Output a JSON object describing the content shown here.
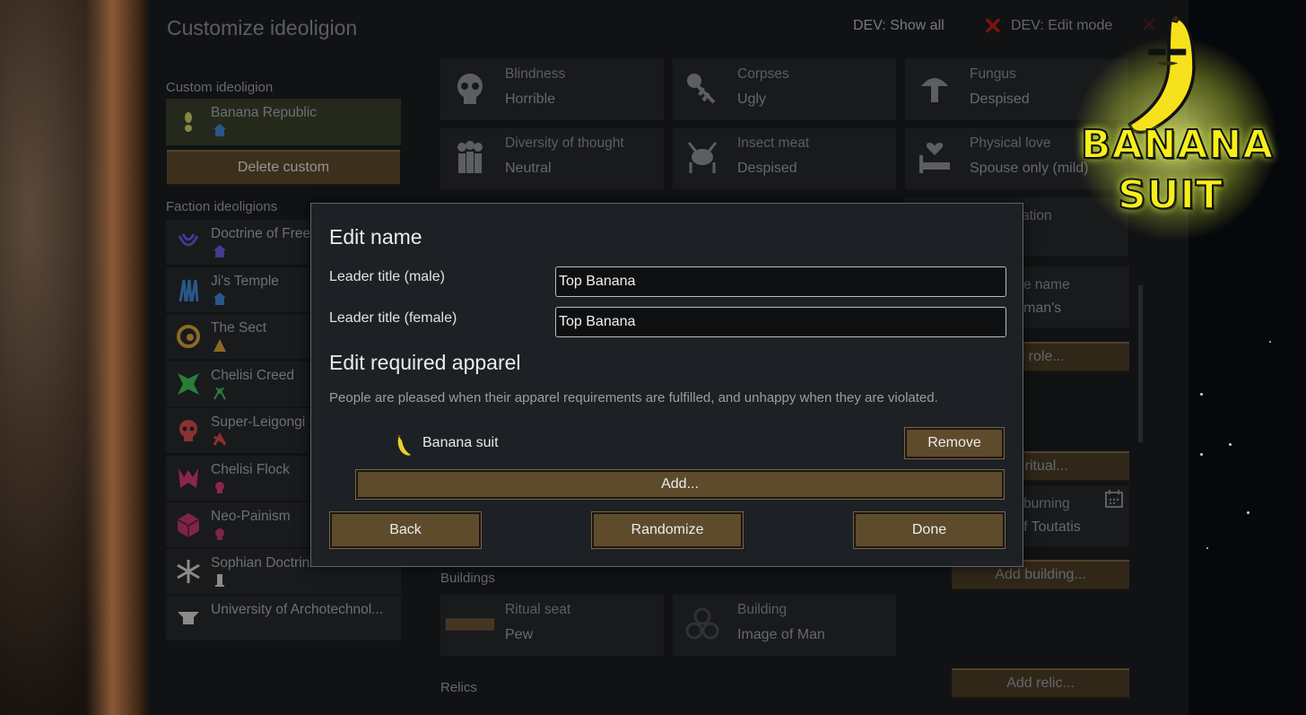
{
  "window": {
    "title": "Customize ideoligion",
    "dev_show_all": "DEV: Show all",
    "dev_edit_mode": "DEV: Edit mode"
  },
  "sidebar": {
    "custom_label": "Custom ideoligion",
    "custom_item": {
      "name": "Banana Republic",
      "icon_color": "#cfcf6a",
      "sub_color": "#3f86d6"
    },
    "delete_button": "Delete custom",
    "faction_label": "Faction ideoligions",
    "factions": [
      {
        "name": "Doctrine of Free",
        "icon_color": "#6a5ad6",
        "sub_color": "#6a5ad6"
      },
      {
        "name": "Ji's Temple",
        "icon_color": "#3f86d6",
        "sub_color": "#3f86d6"
      },
      {
        "name": "The Sect",
        "icon_color": "#d6a23a",
        "sub_color": "#d6a23a"
      },
      {
        "name": "Chelisi Creed",
        "icon_color": "#3fbf5a",
        "sub_color": "#3fbf5a"
      },
      {
        "name": "Super-Leigongi",
        "icon_color": "#d64a4a",
        "sub_color": "#d64a4a"
      },
      {
        "name": "Chelisi Flock",
        "icon_color": "#d63a7a",
        "sub_color": "#d63a7a"
      },
      {
        "name": "Neo-Painism",
        "icon_color": "#c23a6a",
        "sub_color": "#c23a6a"
      },
      {
        "name": "Sophian Doctrin",
        "icon_color": "#d6d6d6",
        "sub_color": "#d6d6d6"
      },
      {
        "name": "University of Archotechnol...",
        "icon_color": "#d6d6d6",
        "sub_color": ""
      }
    ]
  },
  "precepts": [
    {
      "title": "Blindness",
      "value": "Horrible",
      "icon": "skull-icon"
    },
    {
      "title": "Corpses",
      "value": "Ugly",
      "icon": "skeleton-icon"
    },
    {
      "title": "Fungus",
      "value": "Despised",
      "icon": "mushroom-icon"
    },
    {
      "title": "Diversity of thought",
      "value": "Neutral",
      "icon": "people-icon"
    },
    {
      "title": "Insect meat",
      "value": "Despised",
      "icon": "insect-icon"
    },
    {
      "title": "Physical love",
      "value": "Spouse only (mild)",
      "icon": "heart-bed-icon"
    }
  ],
  "right_column": {
    "ation_fragment": "ation",
    "role_name_fragment": "e name",
    "role_value_fragment": "man's",
    "add_role": "d role...",
    "add_ritual": "d ritual...",
    "ritual_name_fragment": "burning",
    "ritual_value_fragment": "f Toutatis",
    "add_building": "Add building...",
    "add_relic": "Add relic..."
  },
  "buildings": {
    "label": "Buildings",
    "items": [
      {
        "title": "Ritual seat",
        "value": "Pew",
        "icon": "pew-icon"
      },
      {
        "title": "Building",
        "value": "Image of Man",
        "icon": "triskele-icon"
      }
    ]
  },
  "relics_label": "Relics",
  "dialog": {
    "edit_name_heading": "Edit name",
    "male_label": "Leader title (male)",
    "male_value": "Top Banana",
    "female_label": "Leader title (female)",
    "female_value": "Top Banana",
    "apparel_heading": "Edit required apparel",
    "apparel_desc": "People are pleased when their apparel requirements are fulfilled, and unhappy when they are violated.",
    "apparel_item": "Banana suit",
    "remove_button": "Remove",
    "add_button": "Add...",
    "back_button": "Back",
    "randomize_button": "Randomize",
    "done_button": "Done"
  },
  "badge": {
    "line1": "BANANA",
    "line2": "SUIT"
  }
}
